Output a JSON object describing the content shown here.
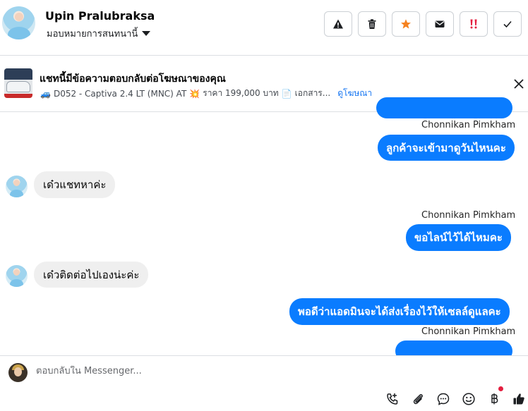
{
  "header": {
    "contact_name": "Upin Pralubraksa",
    "assign_label": "มอบหมายการสนทนานี้",
    "actions": [
      {
        "name": "report-spam-button",
        "icon": "warning-icon"
      },
      {
        "name": "delete-button",
        "icon": "trash-icon"
      },
      {
        "name": "star-button",
        "icon": "star-icon"
      },
      {
        "name": "mark-unread-button",
        "icon": "envelope-icon"
      },
      {
        "name": "priority-button",
        "icon": "exclamation-icon"
      },
      {
        "name": "mark-done-button",
        "icon": "checkmark-icon"
      }
    ]
  },
  "banner": {
    "title": "แชทนี้มีข้อความตอบกลับต่อโฆษณาของคุณ",
    "car_emoji": "🚙",
    "car": "D052 - Captiva 2.4 LT (MNC) AT",
    "price_emoji": "💥",
    "price": "ราคา 199,000 บาท",
    "doc_emoji": "📄",
    "doc": "เอกสาร...",
    "link": "ดูโฆษณา"
  },
  "messages": {
    "sender_1": "Chonnikan Pimkham",
    "out_1": "ลูกค้าจะเข้ามาดูวันไหนคะ",
    "in_1": "เด๋วแชทหาค่ะ",
    "sender_2": "Chonnikan Pimkham",
    "out_2": "ขอไลน์ไว้ได้ไหมคะ",
    "in_2": "เด๋วติดต่อไปเองน่ะค่ะ",
    "out_3": "พอดีว่าแอดมินจะได้ส่งเรื่องไว้ให้เซลล์ดูแลคะ",
    "sender_3": "Chonnikan Pimkham"
  },
  "composer": {
    "placeholder": "ตอบกลับใน Messenger...",
    "tools": [
      "call-add-icon",
      "paperclip-icon",
      "saved-reply-icon",
      "emoji-icon",
      "baht-payment-icon",
      "thumbs-up-icon"
    ]
  },
  "colors": {
    "outgoing_bubble": "#0a7cff",
    "incoming_bubble": "#efefef",
    "link": "#1877f2",
    "star": "#f5821f",
    "priority": "#e41e3f"
  }
}
